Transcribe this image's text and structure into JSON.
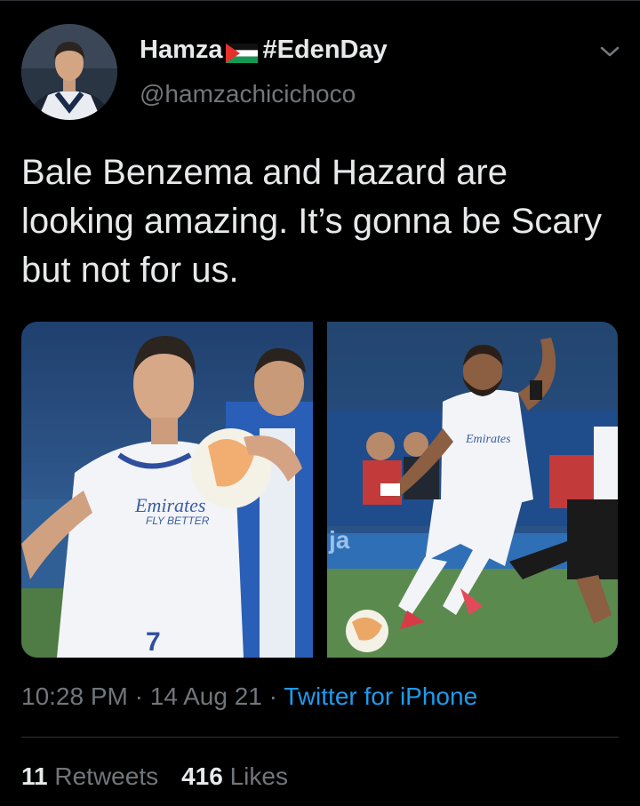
{
  "tweet": {
    "author": {
      "name": "Hamza",
      "flag_icon": "palestine-flag-icon",
      "name_suffix": "#EdenDay",
      "handle": "@hamzachicichoco",
      "avatar": "avatar-photo"
    },
    "menu_icon": "chevron-down-icon",
    "text": "Bale Benzema and Hazard are looking amazing. It’s gonna be Scary but not for us.",
    "media": [
      {
        "kind": "photo",
        "description_icon": "football-photo"
      },
      {
        "kind": "photo",
        "description_icon": "football-photo"
      }
    ],
    "time": "10:28 PM",
    "separator": "·",
    "date": "14 Aug 21",
    "source": "Twitter for iPhone",
    "retweets_count": "11",
    "retweets_label": "Retweets",
    "likes_count": "416",
    "likes_label": "Likes"
  },
  "colors": {
    "background": "#000000",
    "text": "#e7e9ea",
    "secondary": "#71767b",
    "link": "#1d9bf0",
    "divider": "#2f3336"
  }
}
